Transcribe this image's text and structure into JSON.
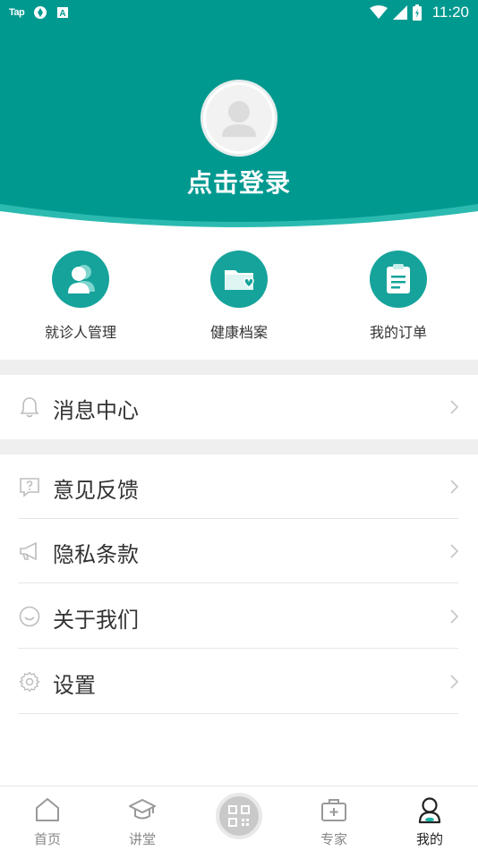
{
  "status_bar": {
    "app_icon_text": "Tap",
    "time": "11:20"
  },
  "header": {
    "login_text": "点击登录",
    "bg_color": "#009990",
    "wave_color": "#2bbab0"
  },
  "shortcuts": [
    {
      "label": "就诊人管理",
      "icon": "patients-icon"
    },
    {
      "label": "健康档案",
      "icon": "health-folder-icon"
    },
    {
      "label": "我的订单",
      "icon": "clipboard-icon"
    }
  ],
  "menu": {
    "message_center": "消息中心",
    "feedback": "意见反馈",
    "privacy": "隐私条款",
    "about": "关于我们",
    "settings": "设置"
  },
  "bottom_nav": {
    "home": "首页",
    "lecture": "讲堂",
    "expert": "专家",
    "mine": "我的"
  },
  "colors": {
    "accent": "#16a39b",
    "active_indicator": "#1bb3a6"
  }
}
